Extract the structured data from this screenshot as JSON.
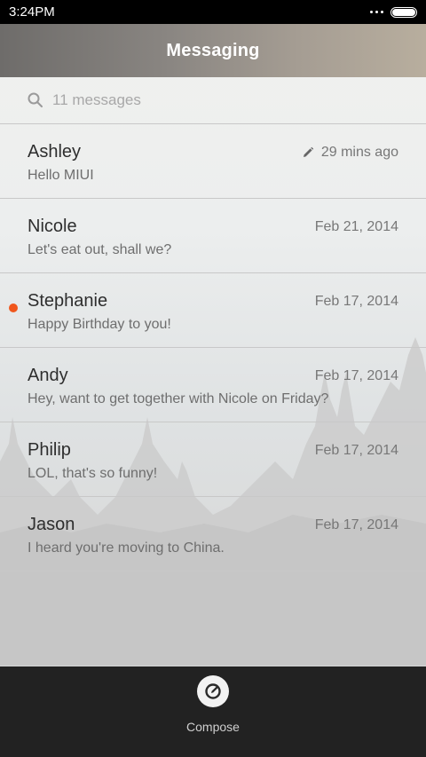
{
  "status_bar": {
    "time": "3:24PM"
  },
  "header": {
    "title": "Messaging"
  },
  "search": {
    "placeholder": "11 messages"
  },
  "messages": [
    {
      "name": "Ashley",
      "preview": "Hello MIUI",
      "time": "29 mins ago",
      "draft": true,
      "unread": false
    },
    {
      "name": "Nicole",
      "preview": "Let's eat out, shall we?",
      "time": "Feb 21, 2014",
      "draft": false,
      "unread": false
    },
    {
      "name": "Stephanie",
      "preview": "Happy Birthday to you!",
      "time": "Feb 17, 2014",
      "draft": false,
      "unread": true
    },
    {
      "name": "Andy",
      "preview": "Hey, want to get together with Nicole on Friday?",
      "time": "Feb 17, 2014",
      "draft": false,
      "unread": false
    },
    {
      "name": "Philip",
      "preview": "LOL, that's so funny!",
      "time": "Feb 17, 2014",
      "draft": false,
      "unread": false
    },
    {
      "name": "Jason",
      "preview": "I heard you're moving to China.",
      "time": "Feb 17, 2014",
      "draft": false,
      "unread": false
    }
  ],
  "bottom_bar": {
    "compose_label": "Compose",
    "compose_icon": "compose-icon"
  },
  "colors": {
    "unread_dot": "#f0561d",
    "bottom_bar": "#222222"
  }
}
